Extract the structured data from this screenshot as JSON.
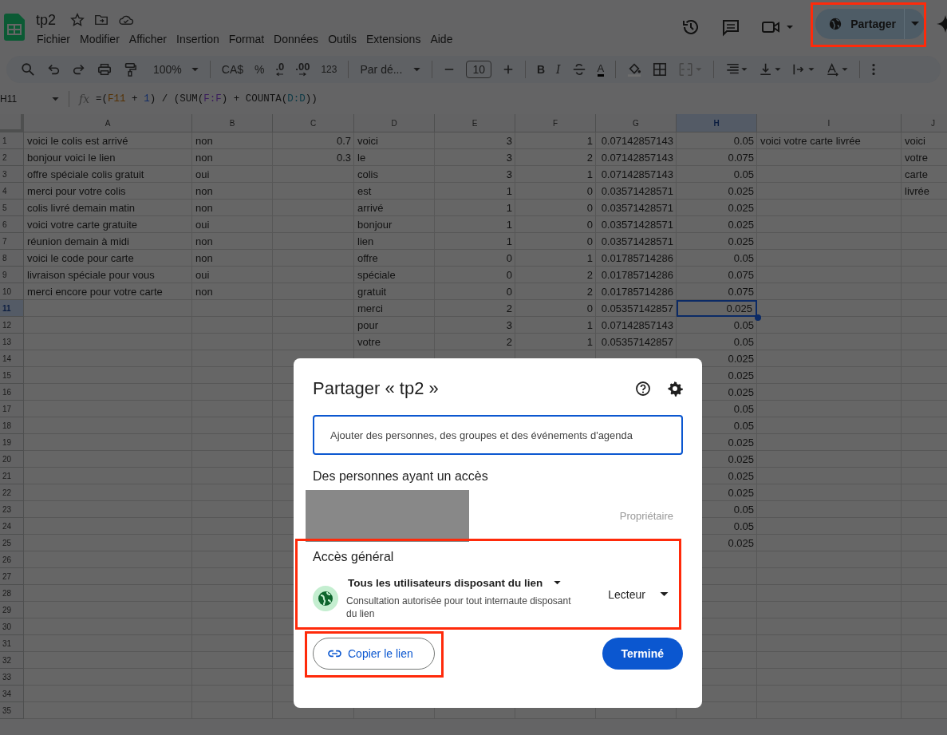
{
  "app": {
    "title": "tp2",
    "menu": [
      "Fichier",
      "Modifier",
      "Afficher",
      "Insertion",
      "Format",
      "Données",
      "Outils",
      "Extensions",
      "Aide"
    ],
    "share_button": {
      "label": "Partager",
      "highlighted": true
    }
  },
  "toolbar": {
    "zoom": "100%",
    "currency": "CA$",
    "percent": "%",
    "decrease_decimals": ".0",
    "increase_decimals": ".00",
    "number_format": "123",
    "font": "Par dé...",
    "font_size": "10",
    "bold": "B",
    "italic": "I",
    "text_color": "A"
  },
  "formula_bar": {
    "cell": "H11",
    "function_label": "fx",
    "formula": [
      {
        "text": "=(",
        "color": "#111111"
      },
      {
        "text": "F11",
        "color": "#553204"
      },
      {
        "text": " + ",
        "color": "#111111"
      },
      {
        "text": "1",
        "color": "#122c66"
      },
      {
        "text": ") / (SUM(",
        "color": "#111111"
      },
      {
        "text": "F:F",
        "color": "#3b1d5c"
      },
      {
        "text": ") + COUNTA(",
        "color": "#111111"
      },
      {
        "text": "D:D",
        "color": "#0d3a46"
      },
      {
        "text": "))",
        "color": "#111111"
      }
    ]
  },
  "sheet": {
    "columns": [
      {
        "label": "A",
        "kind": "text",
        "selected": false
      },
      {
        "label": "B",
        "kind": "text",
        "selected": false
      },
      {
        "label": "C",
        "kind": "number",
        "selected": false
      },
      {
        "label": "D",
        "kind": "text",
        "selected": false
      },
      {
        "label": "E",
        "kind": "number",
        "selected": false
      },
      {
        "label": "F",
        "kind": "number",
        "selected": false
      },
      {
        "label": "G",
        "kind": "number",
        "selected": false
      },
      {
        "label": "H",
        "kind": "number",
        "selected": true
      },
      {
        "label": "I",
        "kind": "text",
        "selected": false
      },
      {
        "label": "J",
        "kind": "text",
        "selected": false
      }
    ],
    "rows": [
      {
        "number": "1",
        "selected": false,
        "cells": [
          "voici le colis est arrivé",
          "non",
          "0.7",
          "voici",
          "3",
          "1",
          "0.07142857143",
          "0.05",
          "voici votre carte livrée",
          "voici"
        ]
      },
      {
        "number": "2",
        "selected": false,
        "cells": [
          "bonjour voici le lien",
          "non",
          "0.3",
          "le",
          "3",
          "2",
          "0.07142857143",
          "0.075",
          null,
          "votre"
        ]
      },
      {
        "number": "3",
        "selected": false,
        "cells": [
          "offre spéciale colis gratuit",
          "oui",
          null,
          "colis",
          "3",
          "1",
          "0.07142857143",
          "0.05",
          null,
          "carte"
        ]
      },
      {
        "number": "4",
        "selected": false,
        "cells": [
          "merci pour votre colis",
          "non",
          null,
          "est",
          "1",
          "0",
          "0.03571428571",
          "0.025",
          null,
          "livrée"
        ]
      },
      {
        "number": "5",
        "selected": false,
        "cells": [
          "colis livré demain matin",
          "non",
          null,
          "arrivé",
          "1",
          "0",
          "0.03571428571",
          "0.025"
        ]
      },
      {
        "number": "6",
        "selected": false,
        "cells": [
          "voici votre carte gratuite",
          "oui",
          null,
          "bonjour",
          "1",
          "0",
          "0.03571428571",
          "0.025"
        ]
      },
      {
        "number": "7",
        "selected": false,
        "cells": [
          "réunion demain à midi",
          "non",
          null,
          "lien",
          "1",
          "0",
          "0.03571428571",
          "0.025"
        ]
      },
      {
        "number": "8",
        "selected": false,
        "cells": [
          "voici le code pour carte",
          "non",
          null,
          "offre",
          "0",
          "1",
          "0.01785714286",
          "0.05"
        ]
      },
      {
        "number": "9",
        "selected": false,
        "cells": [
          "livraison spéciale pour vous",
          "oui",
          null,
          "spéciale",
          "0",
          "2",
          "0.01785714286",
          "0.075"
        ]
      },
      {
        "number": "10",
        "selected": false,
        "cells": [
          "merci encore pour votre carte",
          "non",
          null,
          "gratuit",
          "0",
          "2",
          "0.01785714286",
          "0.075"
        ]
      },
      {
        "number": "11",
        "selected": true,
        "cells": [
          null,
          null,
          null,
          "merci",
          "2",
          "0",
          "0.05357142857",
          "0.025"
        ]
      },
      {
        "number": "12",
        "selected": false,
        "cells": [
          null,
          null,
          null,
          "pour",
          "3",
          "1",
          "0.07142857143",
          "0.05"
        ]
      },
      {
        "number": "13",
        "selected": false,
        "cells": [
          null,
          null,
          null,
          "votre",
          "2",
          "1",
          "0.05357142857",
          "0.05"
        ]
      },
      {
        "number": "14",
        "selected": false,
        "cells": [
          null,
          null,
          null,
          null,
          null,
          null,
          null,
          "0.025"
        ]
      },
      {
        "number": "15",
        "selected": false,
        "cells": [
          null,
          null,
          null,
          null,
          null,
          null,
          null,
          "0.025"
        ]
      },
      {
        "number": "16",
        "selected": false,
        "cells": [
          null,
          null,
          null,
          null,
          null,
          null,
          null,
          "0.025"
        ]
      },
      {
        "number": "17",
        "selected": false,
        "cells": [
          null,
          null,
          null,
          null,
          null,
          null,
          null,
          "0.05"
        ]
      },
      {
        "number": "18",
        "selected": false,
        "cells": [
          null,
          null,
          null,
          null,
          null,
          null,
          null,
          "0.05"
        ]
      },
      {
        "number": "19",
        "selected": false,
        "cells": [
          null,
          null,
          null,
          null,
          null,
          null,
          null,
          "0.025"
        ]
      },
      {
        "number": "20",
        "selected": false,
        "cells": [
          null,
          null,
          null,
          null,
          null,
          null,
          null,
          "0.025"
        ]
      },
      {
        "number": "21",
        "selected": false,
        "cells": [
          null,
          null,
          null,
          null,
          null,
          null,
          null,
          "0.025"
        ]
      },
      {
        "number": "22",
        "selected": false,
        "cells": [
          null,
          null,
          null,
          null,
          null,
          null,
          null,
          "0.025"
        ]
      },
      {
        "number": "23",
        "selected": false,
        "cells": [
          null,
          null,
          null,
          null,
          null,
          null,
          null,
          "0.05"
        ]
      },
      {
        "number": "24",
        "selected": false,
        "cells": [
          null,
          null,
          null,
          null,
          null,
          null,
          null,
          "0.05"
        ]
      },
      {
        "number": "25",
        "selected": false,
        "cells": [
          null,
          null,
          null,
          null,
          null,
          null,
          null,
          "0.025"
        ]
      },
      {
        "number": "26",
        "selected": false
      },
      {
        "number": "27",
        "selected": false
      },
      {
        "number": "28",
        "selected": false
      },
      {
        "number": "29",
        "selected": false
      },
      {
        "number": "30",
        "selected": false
      },
      {
        "number": "31",
        "selected": false
      },
      {
        "number": "32",
        "selected": false
      },
      {
        "number": "33",
        "selected": false
      },
      {
        "number": "34",
        "selected": false
      },
      {
        "number": "35",
        "selected": false
      }
    ]
  },
  "share_dialog": {
    "title": "Partager « tp2 »",
    "search": {
      "placeholder": "Ajouter des personnes, des groupes et des événements d'agenda"
    },
    "people_heading": "Des personnes ayant un accès",
    "people": [
      {
        "redacted": true,
        "role": "Propriétaire"
      }
    ],
    "general_access": {
      "heading": "Accès général",
      "highlighted": true,
      "scope": "Tous les utilisateurs disposant du lien",
      "description": "Consultation autorisée pour tout internaute disposant du lien",
      "role": "Lecteur"
    },
    "copy_link": {
      "label": "Copier le lien",
      "highlighted": true
    },
    "done": "Terminé"
  }
}
